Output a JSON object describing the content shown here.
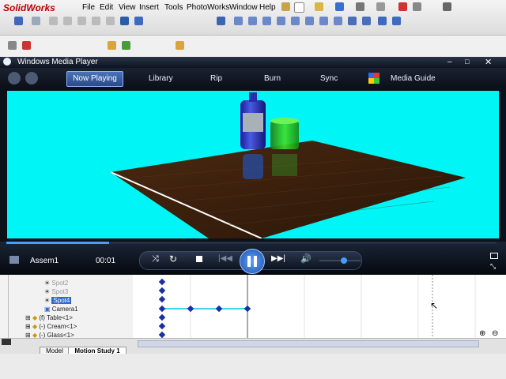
{
  "sw": {
    "logo": "SolidWorks",
    "menus": [
      "File",
      "Edit",
      "View",
      "Insert",
      "Tools",
      "PhotoWorks",
      "Window",
      "Help"
    ]
  },
  "wmp": {
    "title": "Windows Media Player",
    "tabs": [
      "Now Playing",
      "Library",
      "Rip",
      "Burn",
      "Sync",
      "Media Guide"
    ],
    "media_name": "Assem1",
    "time": "00:01",
    "seek_progress": 0.21,
    "volume_level": 0.6
  },
  "tree": {
    "items": [
      "Spot2",
      "Spot3",
      "Spot4",
      "Camera1",
      "(f) Table<1>",
      "(-) Cream<1>",
      "(-) Glass<1>"
    ]
  },
  "tabs_bottom": [
    "Model",
    "Motion Study 1"
  ],
  "colors": {
    "video_bg": "#00f6f6",
    "wmp_bg": "#0c1018",
    "accent": "#3fa0ff"
  }
}
